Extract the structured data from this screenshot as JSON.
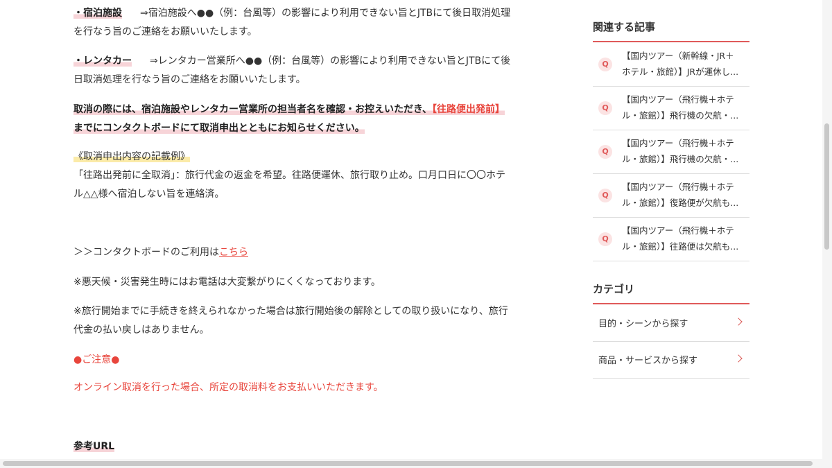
{
  "article": {
    "p1_label": "・宿泊施設",
    "p1_line1": "⇒宿泊施設へ●●（例：台風等）の影響により利用できない旨とJTBにて後日取消処理",
    "p1_line2": "を行なう旨のご連絡をお願いいたします。",
    "p2_label": "・レンタカー",
    "p2_line1": "⇒レンタカー営業所へ●●（例：台風等）の影響により利用できない旨とJTBにて後",
    "p2_line2": "日取消処理を行なう旨のご連絡をお願いいたします。",
    "p3_line1": "取消の際には、宿泊施設やレンタカー営業所の担当者名を確認・お控えいただき、",
    "p3_red": "【往路便出発前】",
    "p3_line2": "までにコンタクトボードにて取消申出とともにお知らせください。",
    "example_heading": "《取消申出内容の記載例》",
    "example_line1": "「往路出発前に全取消」：旅行代金の返金を希望。往路便運休、旅行取り止め。口月口日に〇〇ホテ",
    "example_line2": "ル△△様へ宿泊しない旨を連絡済。",
    "contact_prefix": "＞＞コンタクトボードのご利用は",
    "contact_link": "こちら",
    "note1": "※悪天候・災害発生時にはお電話は大変繋がりにくくなっております。",
    "note2_line1": "※旅行開始までに手続きを終えられなかった場合は旅行開始後の解除としての取り扱いになり、旅行",
    "note2_line2": "代金の払い戻しはありません。",
    "caution_heading": "●ご注意●",
    "caution_text": "オンライン取消を行った場合、所定の取消料をお支払いいただきます。",
    "ref_heading": "参考URL"
  },
  "sidebar": {
    "related_heading": "関連する記事",
    "q_label": "Q",
    "related": [
      {
        "line1": "【国内ツアー（新幹線・JR＋",
        "line2": "ホテル・旅館）】JRが運休し..."
      },
      {
        "line1": "【国内ツアー（飛行機＋ホテ",
        "line2": "ル・旅館）】飛行機の欠航・..."
      },
      {
        "line1": "【国内ツアー（飛行機＋ホテ",
        "line2": "ル・旅館）】飛行機の欠航・..."
      },
      {
        "line1": "【国内ツアー（飛行機＋ホテ",
        "line2": "ル・旅館）】復路便が欠航も..."
      },
      {
        "line1": "【国内ツアー（飛行機＋ホテ",
        "line2": "ル・旅館）】往路便は欠航も..."
      }
    ],
    "category_heading": "カテゴリ",
    "categories": [
      {
        "label": "目的・シーンから探す"
      },
      {
        "label": "商品・サービスから探す"
      }
    ]
  },
  "colors": {
    "accent": "#e05a5a",
    "red_text": "#e8453c",
    "pink_highlight": "#f7d4d8",
    "yellow_highlight": "#fbeba9"
  },
  "icons": {
    "related_badge": "q-badge",
    "category_arrow": "chevron-right-icon"
  }
}
